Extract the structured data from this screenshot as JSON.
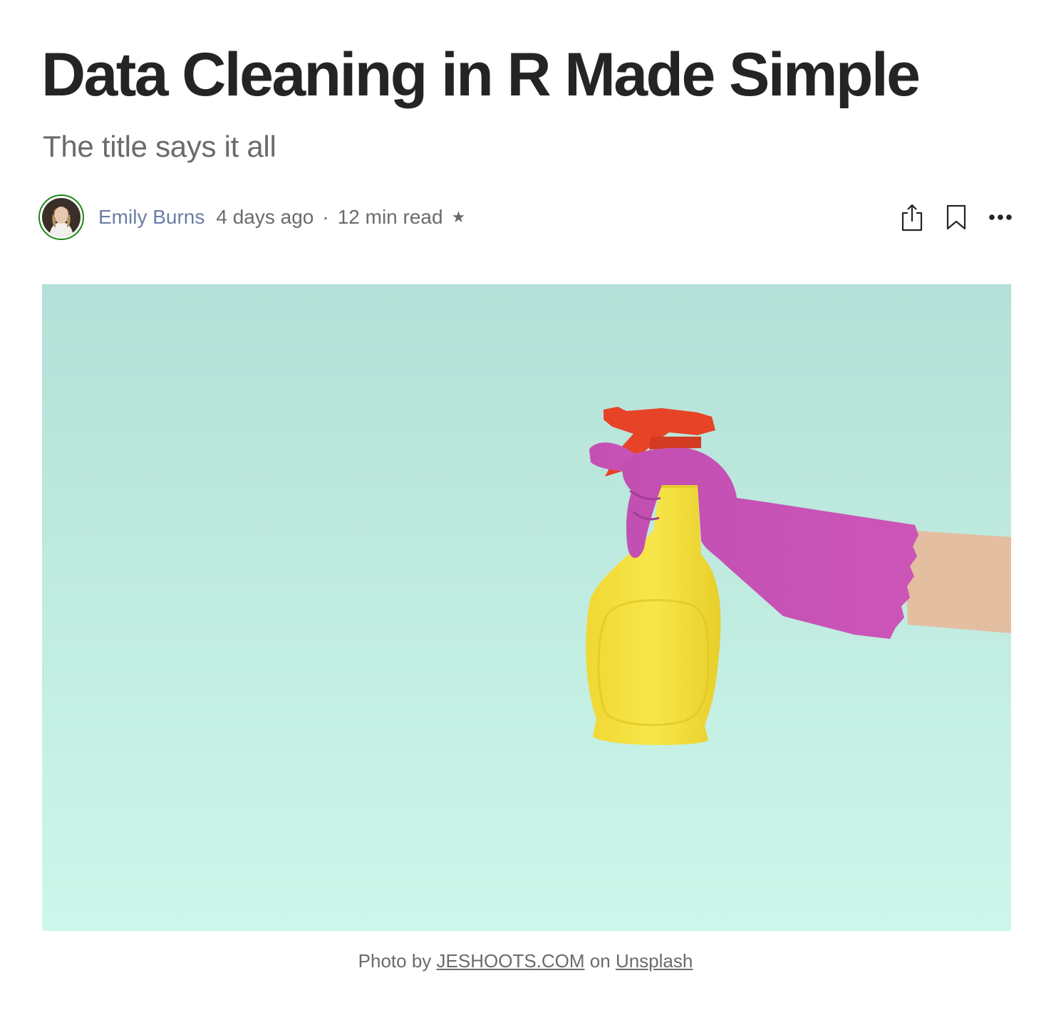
{
  "article": {
    "title": "Data Cleaning in R Made Simple",
    "subtitle": "The title says it all"
  },
  "byline": {
    "author": "Emily Burns",
    "published": "4 days ago",
    "separator": "·",
    "read_time": "12 min read",
    "member_star": "★"
  },
  "actions": {
    "share_icon": "share-icon",
    "bookmark_icon": "bookmark-icon",
    "more_icon": "more-icon"
  },
  "hero": {
    "alt": "Hand in purple rubber glove holding yellow spray bottle",
    "background_color": "#bfe9dc",
    "caption": {
      "prefix": "Photo by",
      "photographer": "JESHOOTS.COM",
      "middle": "on",
      "source": "Unsplash"
    }
  },
  "colors": {
    "text": "#242424",
    "muted": "#6b6b6b",
    "author": "#6a7ea5",
    "ring": "#1a8917"
  }
}
